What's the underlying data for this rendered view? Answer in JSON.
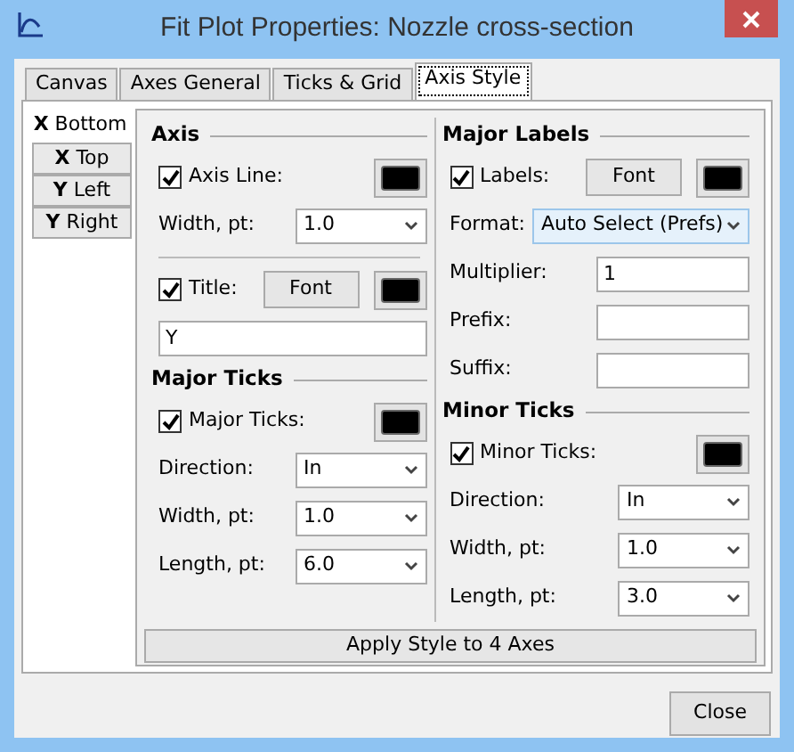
{
  "window": {
    "title": "Fit Plot Properties: Nozzle cross-section"
  },
  "tabs": [
    {
      "label": "Canvas",
      "selected": false
    },
    {
      "label": "Axes General",
      "selected": false
    },
    {
      "label": "Ticks & Grid",
      "selected": false
    },
    {
      "label": "Axis Style",
      "selected": true
    }
  ],
  "side_tabs": [
    {
      "label": "**X** Bottom",
      "selected": true
    },
    {
      "label": "**X** Top",
      "selected": false
    },
    {
      "label": "**Y** Left",
      "selected": false
    },
    {
      "label": "**Y** Right",
      "selected": false
    }
  ],
  "columns": [
    [
      {
        "kind": "heading",
        "text": "Axis"
      },
      {
        "kind": "check",
        "label": "Axis Line:",
        "checked": true,
        "color": "#000000"
      },
      {
        "kind": "select",
        "label": "Width, pt:",
        "value": "1.0",
        "focused": false
      },
      {
        "kind": "divider"
      },
      {
        "kind": "check",
        "label": "Title:",
        "checked": true,
        "font": "Font",
        "color": "#000000"
      },
      {
        "kind": "input",
        "value": "Y"
      },
      {
        "kind": "heading",
        "text": "Major Ticks"
      },
      {
        "kind": "check",
        "label": "Major Ticks:",
        "checked": true,
        "color": "#000000"
      },
      {
        "kind": "select",
        "label": "Direction:",
        "value": "In",
        "focused": false
      },
      {
        "kind": "select",
        "label": "Width, pt:",
        "value": "1.0",
        "focused": false
      },
      {
        "kind": "select",
        "label": "Length, pt:",
        "value": "6.0",
        "focused": false
      }
    ],
    [
      {
        "kind": "heading",
        "text": "Major Labels"
      },
      {
        "kind": "check",
        "label": "Labels:",
        "checked": true,
        "font": "Font",
        "color": "#000000"
      },
      {
        "kind": "select",
        "label": "Format:",
        "value": "Auto Select (Prefs)",
        "focused": true
      },
      {
        "kind": "input",
        "label": "Multiplier:",
        "value": "1"
      },
      {
        "kind": "input",
        "label": "Prefix:"
      },
      {
        "kind": "input",
        "label": "Suffix:"
      },
      {
        "kind": "heading",
        "text": "Minor Ticks"
      },
      {
        "kind": "check",
        "label": "Minor Ticks:",
        "checked": true,
        "color": "#000000"
      },
      {
        "kind": "select",
        "label": "Direction:",
        "value": "In",
        "focused": false
      },
      {
        "kind": "select",
        "label": "Width, pt:",
        "value": "1.0",
        "focused": false
      },
      {
        "kind": "select",
        "label": "Length, pt:",
        "value": "3.0",
        "focused": false
      }
    ]
  ],
  "apply_button": "Apply Style to 4 Axes",
  "close_button": "Close"
}
